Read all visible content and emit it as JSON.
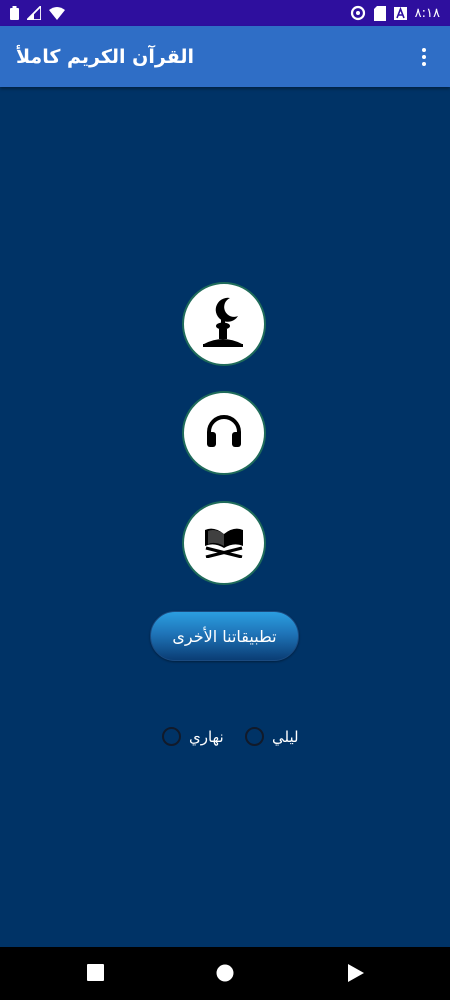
{
  "status_bar": {
    "time": "٨:١٨",
    "left_icons": [
      "battery-icon",
      "signal-icon",
      "wifi-icon"
    ],
    "right_icons": [
      "data-saver-icon",
      "sd-card-icon",
      "notification-a-icon"
    ]
  },
  "app_bar": {
    "title": "القرآن الكريم كاملأ",
    "menu_icon": "more-vertical-icon"
  },
  "main": {
    "buttons": [
      {
        "icon": "mosque-crescent-icon"
      },
      {
        "icon": "headphones-icon"
      },
      {
        "icon": "quran-book-icon"
      }
    ],
    "other_apps_label": "تطبيقاتنا الأخرى",
    "theme_options": [
      {
        "label": "ليلي",
        "selected": false
      },
      {
        "label": "نهاري",
        "selected": false
      }
    ]
  },
  "nav_bar": {
    "icons": [
      "recents-icon",
      "home-icon",
      "back-icon"
    ]
  },
  "colors": {
    "status_bar": "#2e0f9e",
    "app_bar": "#2f6ec6",
    "background": "#003366",
    "nav_bar": "#000000"
  }
}
